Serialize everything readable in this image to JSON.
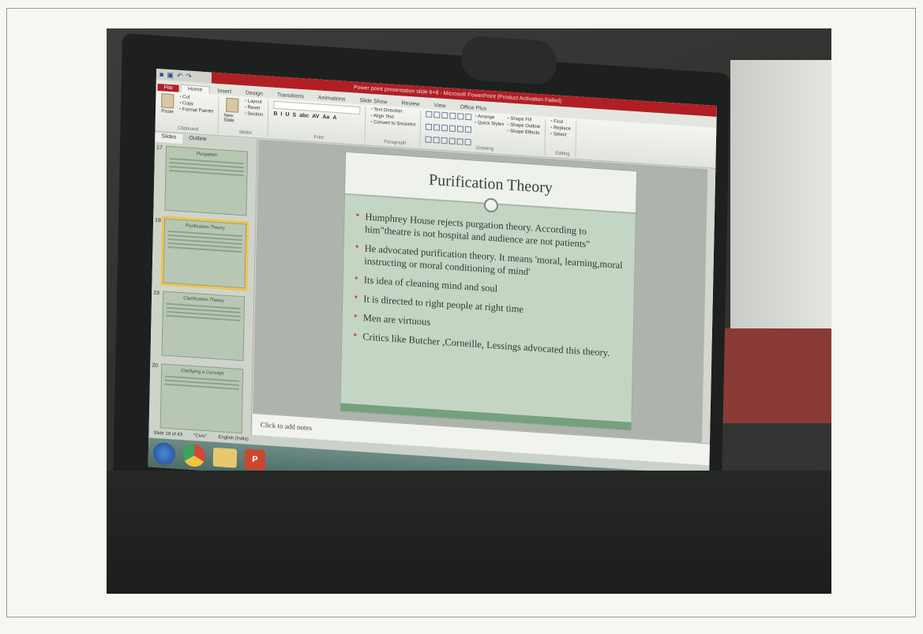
{
  "window": {
    "title": "Power point presentation slide 6+8 - Microsoft PowerPoint (Product Activation Failed)"
  },
  "ribbon": {
    "tabs": [
      "File",
      "Home",
      "Insert",
      "Design",
      "Transitions",
      "Animations",
      "Slide Show",
      "Review",
      "View",
      "Office Plus"
    ],
    "clipboard": {
      "paste": "Paste",
      "cut": "Cut",
      "copy": "Copy",
      "format_painter": "Format Painter",
      "group": "Clipboard"
    },
    "slides": {
      "new_slide": "New Slide",
      "layout": "Layout",
      "reset": "Reset",
      "section": "Section",
      "group": "Slides"
    },
    "font": {
      "group": "Font",
      "buttons": [
        "B",
        "I",
        "U",
        "S",
        "abc",
        "AV",
        "Aa",
        "A"
      ]
    },
    "paragraph": {
      "group": "Paragraph",
      "text_direction": "Text Direction",
      "align_text": "Align Text",
      "convert": "Convert to SmartArt"
    },
    "drawing": {
      "group": "Drawing",
      "arrange": "Arrange",
      "quick_styles": "Quick Styles",
      "shape_fill": "Shape Fill",
      "shape_outline": "Shape Outline",
      "shape_effects": "Shape Effects"
    },
    "editing": {
      "group": "Editing",
      "find": "Find",
      "replace": "Replace",
      "select": "Select"
    }
  },
  "slides_pane": {
    "tabs": [
      "Slides",
      "Outline"
    ],
    "thumbnails": [
      {
        "number": "17",
        "title": "Purgation"
      },
      {
        "number": "18",
        "title": "Purification Theory"
      },
      {
        "number": "19",
        "title": "Clarification Theory"
      },
      {
        "number": "20",
        "title": "Clarifying a Concept"
      }
    ]
  },
  "slide": {
    "title": "Purification Theory",
    "bullets": [
      "Humphrey House rejects purgation theory. According to him\"theatre is not hospital and audience are not patients\"",
      "He advocated purification theory. It means 'moral, learning,moral instructing or moral conditioning of mind'",
      "Its idea of cleaning mind and soul",
      "It is directed to right people at right time",
      "Men are virtuous",
      "Critics like Butcher ,Corneille, Lessings advocated this theory."
    ]
  },
  "notes": {
    "placeholder": "Click to add notes"
  },
  "status_bar": {
    "slide_count": "Slide 18 of 43",
    "theme": "\"Civic\"",
    "language": "English (India)"
  },
  "taskbar": {
    "apps": [
      "windows-start",
      "chrome",
      "explorer",
      "powerpoint"
    ],
    "ppt_label": "P"
  },
  "colors": {
    "title_bar": "#b01f24",
    "slide_bg": "#c5d5c4",
    "bullet": "#c0504d",
    "taskbar": "#5c7b76"
  }
}
